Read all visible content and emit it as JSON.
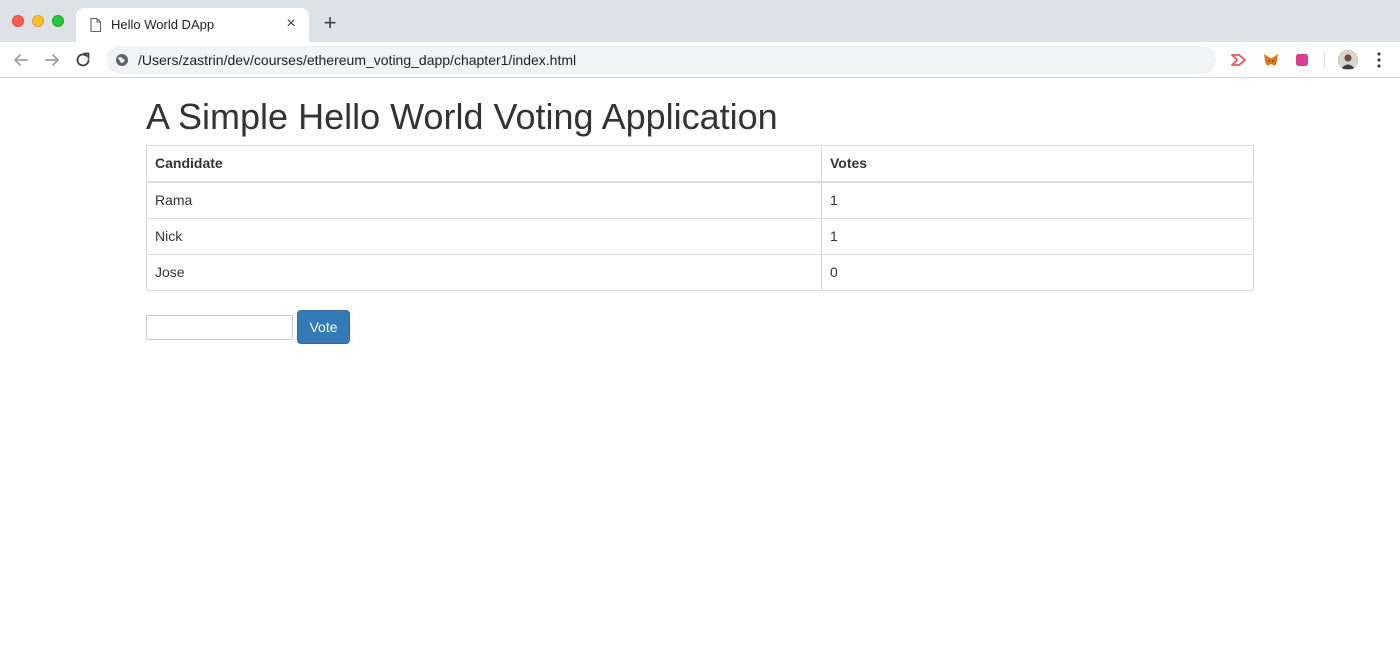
{
  "browser": {
    "tab": {
      "title": "Hello World DApp",
      "close_glyph": "×"
    },
    "new_tab_glyph": "+",
    "address_bar": {
      "url": "/Users/zastrin/dev/courses/ethereum_voting_dapp/chapter1/index.html"
    },
    "icons": {
      "back": "arrow-back-icon",
      "forward": "arrow-forward-icon",
      "reload": "reload-icon",
      "site_info": "globe-icon",
      "menu": "more-vert-icon"
    },
    "extension_colors": [
      "#ee5a5a",
      "#e2761b",
      "#d6428f"
    ]
  },
  "page": {
    "title": "A Simple Hello World Voting Application",
    "table": {
      "headers": [
        "Candidate",
        "Votes"
      ],
      "rows": [
        {
          "candidate": "Rama",
          "votes": "1"
        },
        {
          "candidate": "Nick",
          "votes": "1"
        },
        {
          "candidate": "Jose",
          "votes": "0"
        }
      ]
    },
    "form": {
      "input_value": "",
      "vote_label": "Vote"
    },
    "colors": {
      "button": "#337ab7",
      "text": "#333333"
    }
  }
}
